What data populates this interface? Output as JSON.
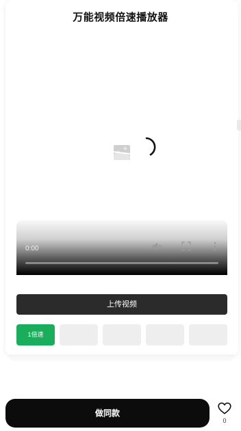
{
  "header": {
    "title": "万能视频倍速播放器"
  },
  "player": {
    "current_time": "0:00",
    "progress": 0,
    "status": "loading",
    "icons": [
      "broken-image-icon",
      "loading-spinner-icon",
      "mute-icon",
      "fullscreen-icon",
      "more-options-icon"
    ]
  },
  "upload": {
    "label": "上传视频"
  },
  "speeds": [
    {
      "label": "1倍速",
      "active": true
    },
    {
      "label": "",
      "active": false
    },
    {
      "label": "",
      "active": false
    },
    {
      "label": "",
      "active": false
    },
    {
      "label": "",
      "active": false
    }
  ],
  "bottom": {
    "action_label": "做同款",
    "like_count": "0",
    "icons": [
      "heart-icon"
    ]
  },
  "colors": {
    "accent_green": "#1aad5c",
    "button_dark": "#2b2b2b",
    "cta_black": "#0c0c0c"
  }
}
